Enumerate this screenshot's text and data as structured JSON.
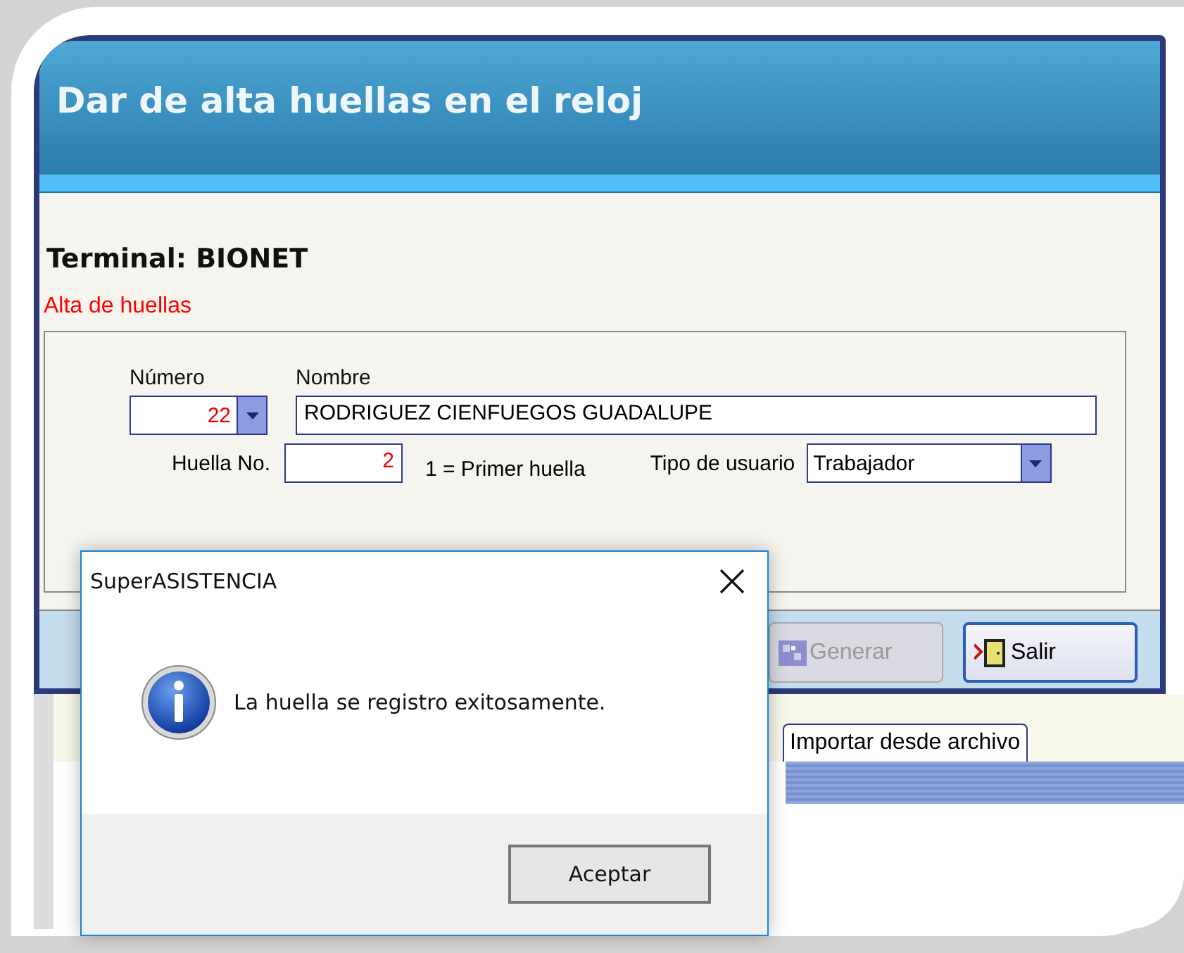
{
  "window": {
    "title": "Dar de alta huellas en el reloj"
  },
  "terminal": "Terminal: BIONET",
  "section": "Alta de huellas",
  "form": {
    "numero": {
      "label": "Número",
      "value": "22"
    },
    "nombre": {
      "label": "Nombre",
      "value": "RODRIGUEZ CIENFUEGOS GUADALUPE"
    },
    "huella": {
      "label": "Huella No.",
      "value": "2",
      "hint": "1 = Primer huella"
    },
    "tipo": {
      "label": "Tipo de usuario",
      "value": "Trabajador"
    }
  },
  "buttons": [
    {
      "label": "Generar",
      "kind": "generate",
      "disabled": true
    },
    {
      "label": "Salir",
      "kind": "exit",
      "disabled": false
    }
  ],
  "tabs": [
    {
      "label": "Importar desde archivo",
      "selected": true
    }
  ],
  "dialog": {
    "title": "SuperASISTENCIA",
    "message": "La huella se registro exitosamente.",
    "button": "Aceptar"
  }
}
